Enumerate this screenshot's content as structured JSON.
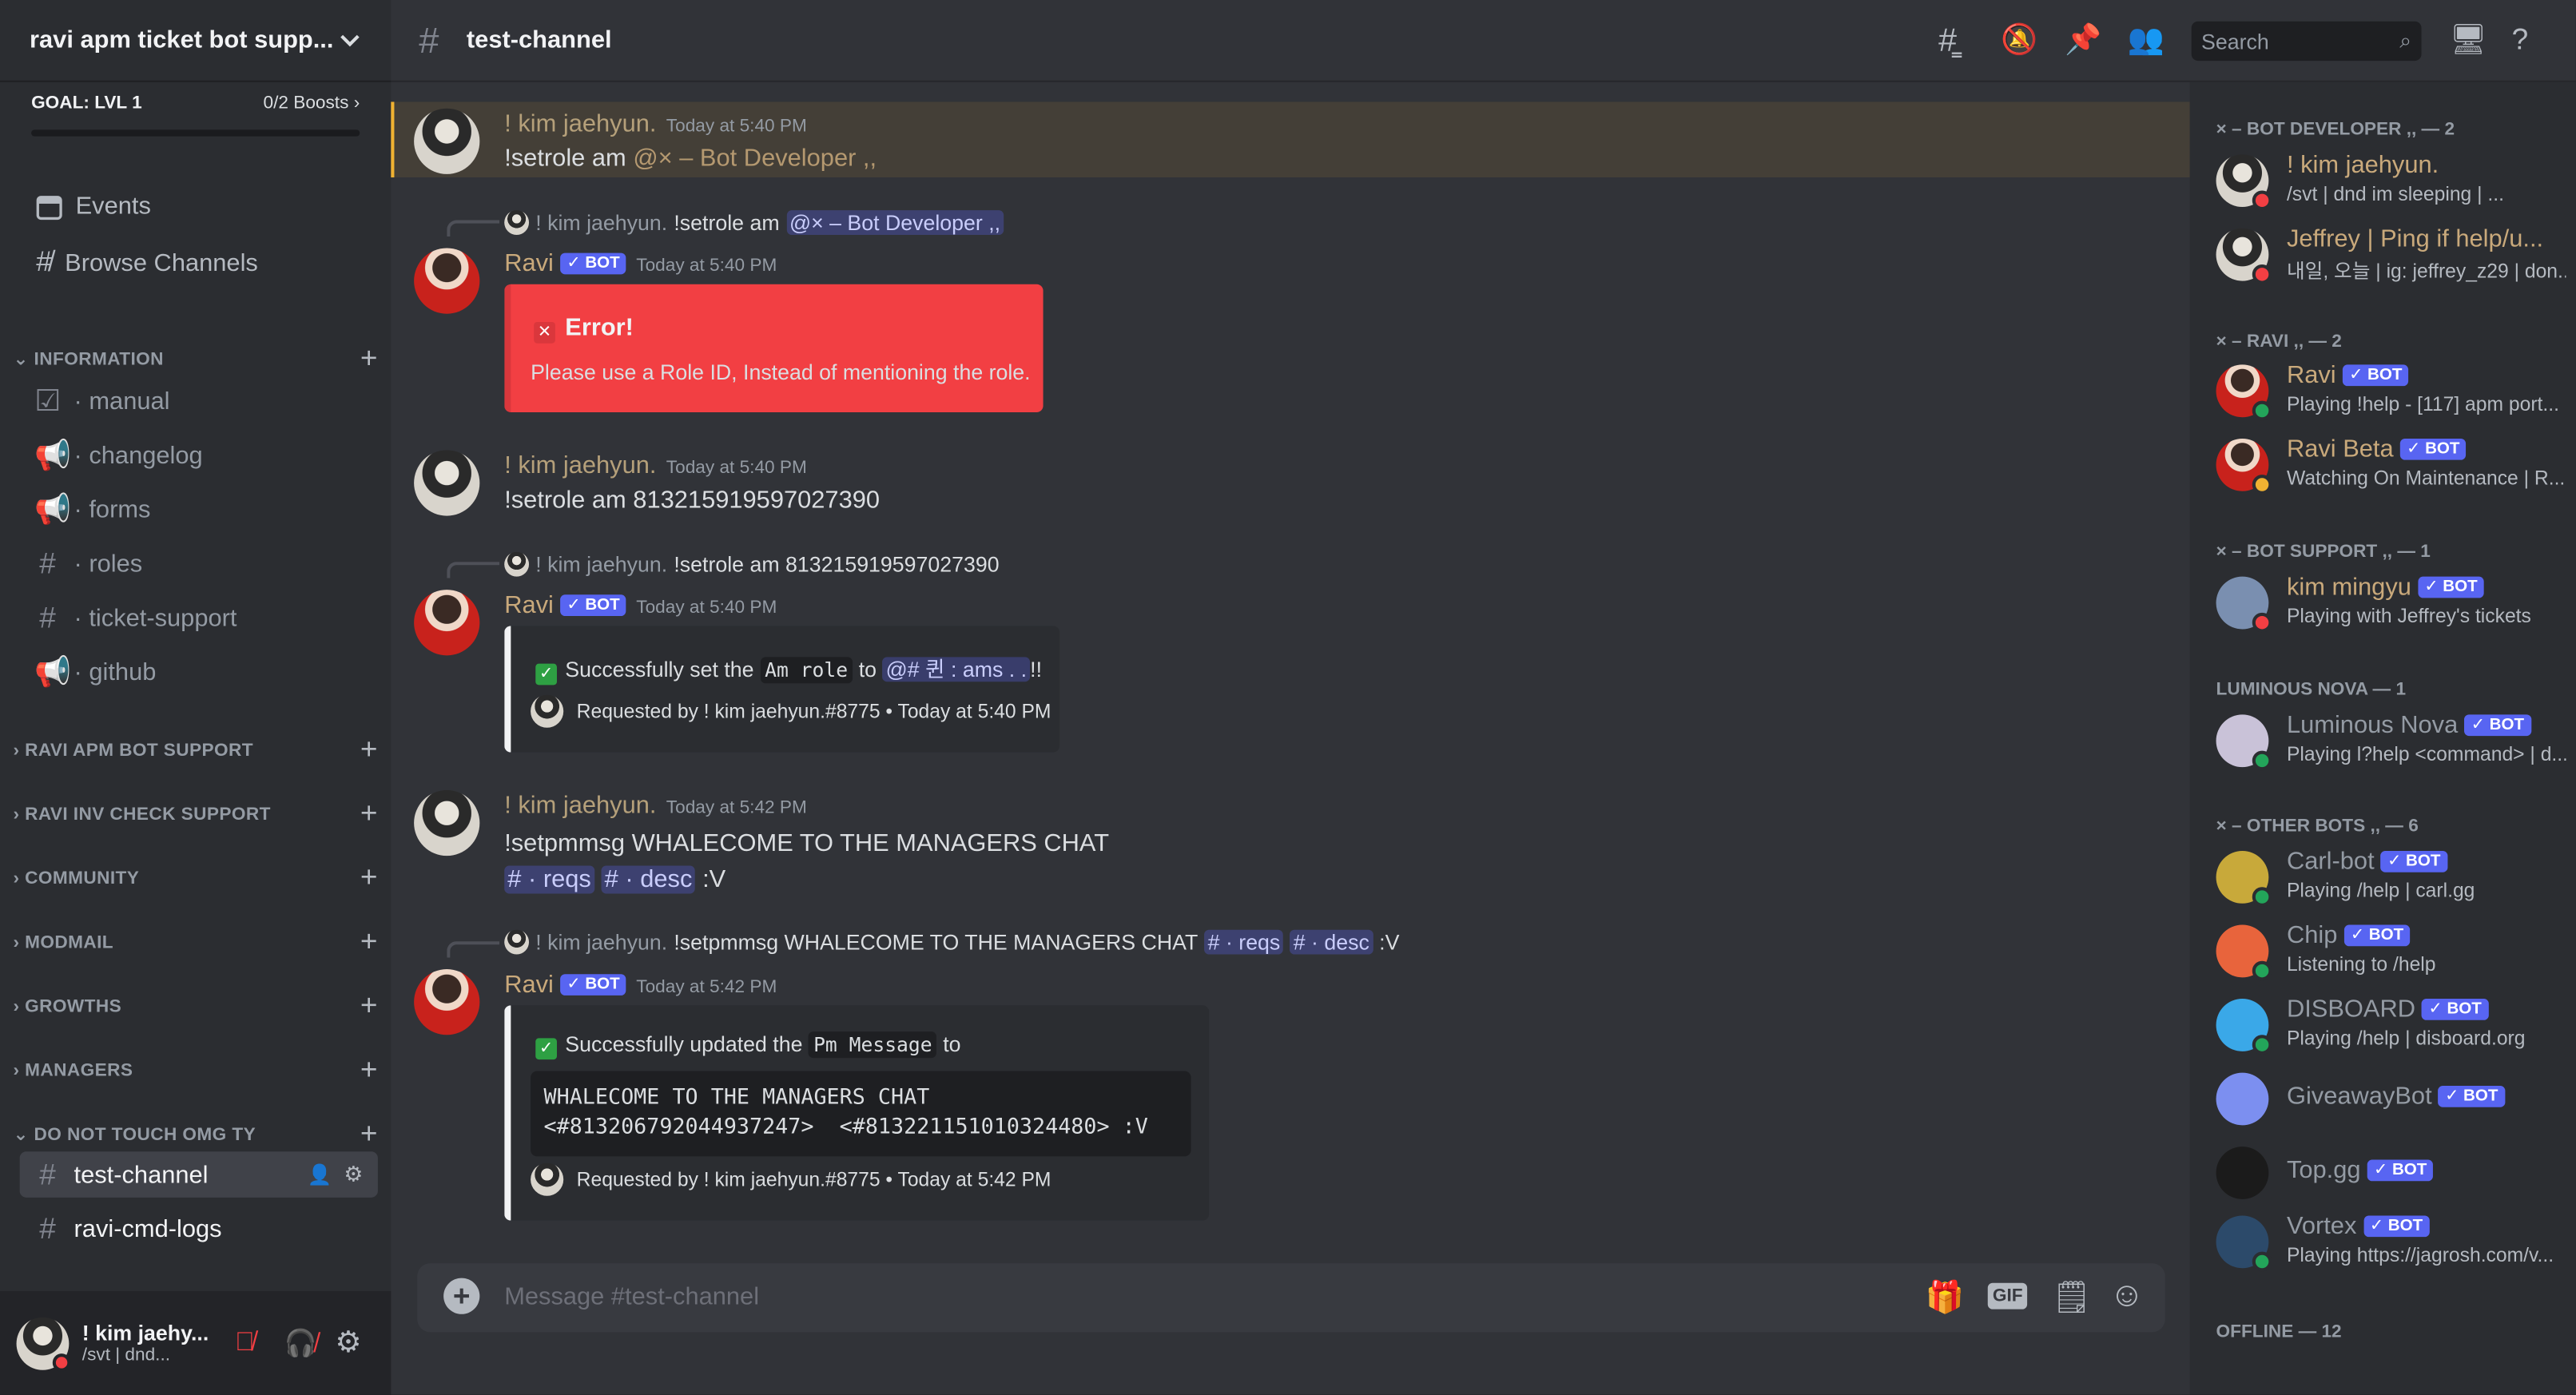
{
  "server": {
    "name": "ravi apm ticket bot supp...",
    "goal_label": "GOAL: LVL 1",
    "boosts": "0/2 Boosts"
  },
  "nav": {
    "events": "Events",
    "browse": "Browse Channels"
  },
  "categories": {
    "information": "INFORMATION",
    "ravi_apm": "RAVI APM BOT SUPPORT",
    "ravi_inv": "RAVI INV CHECK SUPPORT",
    "community": "COMMUNITY",
    "modmail": "MODMAIL",
    "growths": "GROWTHS",
    "managers": "MANAGERS",
    "do_not_touch": "DO NOT TOUCH OMG TY"
  },
  "channels": {
    "manual": "· manual",
    "changelog": "· changelog",
    "forms": "· forms",
    "roles": "· roles",
    "ticket_support": "· ticket-support",
    "github": "· github",
    "test_channel": "test-channel",
    "ravi_cmd_logs": "ravi-cmd-logs"
  },
  "user": {
    "name": "! kim jaehy...",
    "status": "/svt | dnd..."
  },
  "header": {
    "channel": "test-channel",
    "search_placeholder": "Search"
  },
  "messages": {
    "m1": {
      "author": "! kim jaehyun.",
      "time": "Today at 5:40 PM",
      "text": "!setrole am ",
      "mention": "@× – Bot Developer ,,"
    },
    "m2": {
      "reply_author": "! kim jaehyun.",
      "reply_text": "!setrole am",
      "reply_mention": "@× – Bot Developer ,,",
      "author": "Ravi",
      "bot": "BOT",
      "time": "Today at 5:40 PM",
      "embed_title": "Error!",
      "embed_desc": "Please use a Role ID, Instead of mentioning the role."
    },
    "m3": {
      "author": "! kim jaehyun.",
      "time": "Today at 5:40 PM",
      "text": "!setrole am 813215919597027390"
    },
    "m4": {
      "reply_author": "! kim jaehyun.",
      "reply_text": "!setrole am 813215919597027390",
      "author": "Ravi",
      "bot": "BOT",
      "time": "Today at 5:40 PM",
      "embed_pre": "Successfully set the",
      "embed_code": "Am role",
      "embed_mid": "to",
      "embed_mention": "@# 퀸 : ams . .",
      "embed_post": "!!",
      "footer": "Requested by ! kim jaehyun.#8775 • Today at 5:40 PM"
    },
    "m5": {
      "author": "! kim jaehyun.",
      "time": "Today at 5:42 PM",
      "line1": "!setpmmsg WHALECOME TO THE MANAGERS CHAT",
      "ch1": "# · reqs",
      "ch2": "# · desc",
      "tail": ":V"
    },
    "m6": {
      "reply_author": "! kim jaehyun.",
      "reply_text": "!setpmmsg WHALECOME TO THE MANAGERS CHAT",
      "reply_ch1": "# · reqs",
      "reply_ch2": "# · desc",
      "reply_tail": ":V",
      "author": "Ravi",
      "bot": "BOT",
      "time": "Today at 5:42 PM",
      "embed_pre": "Successfully updated the",
      "embed_code": "Pm Message",
      "embed_post": "to",
      "codeblock": "WHALECOME TO THE MANAGERS CHAT\n<#813206792044937247>  <#813221151010324480> :V",
      "footer": "Requested by ! kim jaehyun.#8775 • Today at 5:42 PM"
    }
  },
  "composer": {
    "placeholder": "Message #test-channel",
    "gif": "GIF"
  },
  "members": {
    "roles": {
      "botdev": "× – BOT DEVELOPER ,, — 2",
      "ravi": "× – RAVI ,, — 2",
      "botsupport": "× – BOT SUPPORT ,, — 1",
      "luminous": "LUMINOUS NOVA — 1",
      "otherbots": "× – OTHER BOTS ,, — 6",
      "offline": "OFFLINE — 12"
    },
    "list": [
      {
        "name": "! kim jaehyun.",
        "activity": "/svt | dnd im sleeping | ...",
        "color": "#c9a97b"
      },
      {
        "name": "Jeffrey | Ping if help/u...",
        "activity": "내일, 오늘 | ig: jeffrey_z29 | don...",
        "color": "#c9a97b"
      },
      {
        "name": "Ravi",
        "activity": "Playing !help - [117] apm port...",
        "color": "#c9a97b",
        "bot": "BOT"
      },
      {
        "name": "Ravi Beta",
        "activity": "Watching On Maintenance | R...",
        "color": "#c9a97b",
        "bot": "BOT"
      },
      {
        "name": "kim mingyu",
        "activity": "Playing with Jeffrey's tickets",
        "color": "#c9a97b",
        "bot": "BOT"
      },
      {
        "name": "Luminous Nova",
        "activity": "Playing l?help <command> | d...",
        "color": "#949ba4",
        "bot": "BOT"
      },
      {
        "name": "Carl-bot",
        "activity": "Playing /help | carl.gg",
        "color": "#949ba4",
        "bot": "BOT"
      },
      {
        "name": "Chip",
        "activity": "Listening to /help",
        "color": "#949ba4",
        "bot": "BOT"
      },
      {
        "name": "DISBOARD",
        "activity": "Playing /help | disboard.org",
        "color": "#949ba4",
        "bot": "BOT"
      },
      {
        "name": "GiveawayBot",
        "activity": "",
        "color": "#949ba4",
        "bot": "BOT"
      },
      {
        "name": "Top.gg",
        "activity": "",
        "color": "#949ba4",
        "bot": "BOT"
      },
      {
        "name": "Vortex",
        "activity": "Playing https://jagrosh.com/v...",
        "color": "#949ba4",
        "bot": "BOT"
      }
    ]
  }
}
